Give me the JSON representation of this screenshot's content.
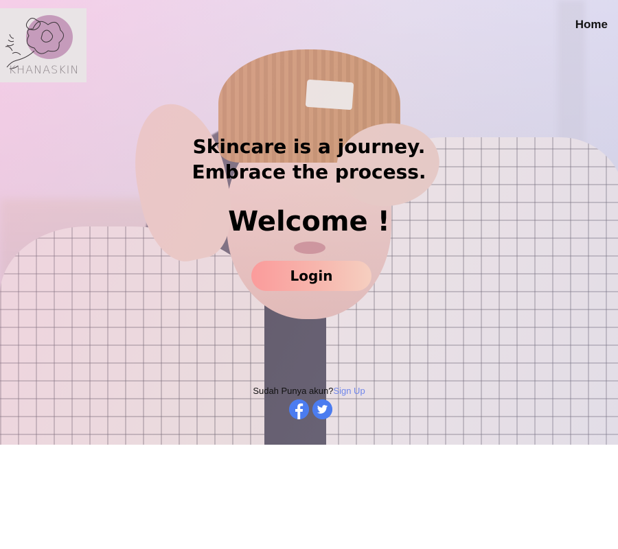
{
  "logo": {
    "text": "KHANASKIN",
    "accent_color": "#c59bbb"
  },
  "nav": {
    "home_label": "Home"
  },
  "hero": {
    "tagline_line1": "Skincare is a journey.",
    "tagline_line2": "Embrace the process.",
    "welcome": "Welcome !",
    "login_label": "Login"
  },
  "footer": {
    "question": "Sudah Punya akun?",
    "signup_label": "Sign Up",
    "social_icons": [
      "facebook-icon",
      "twitter-icon"
    ],
    "social_color": "#4b7cf0"
  }
}
